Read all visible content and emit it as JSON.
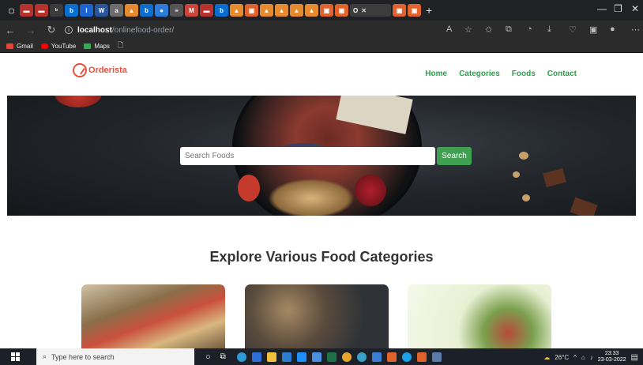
{
  "browser": {
    "active_tab_label": "O",
    "address": {
      "host": "localhost",
      "path": "/onlinefood-order/"
    },
    "bookmarks": [
      {
        "label": "Gmail",
        "color": "#e94335"
      },
      {
        "label": "YouTube",
        "color": "#ff0000"
      },
      {
        "label": "Maps",
        "color": "#34a853"
      }
    ]
  },
  "site": {
    "logo_text": "Orderista",
    "menu": [
      "Home",
      "Categories",
      "Foods",
      "Contact"
    ],
    "search_placeholder": "Search Foods",
    "search_button": "Search",
    "section_title": "Explore Various Food Categories"
  },
  "taskbar": {
    "search_placeholder": "Type here to search",
    "temperature": "26°C",
    "time": "23:33",
    "date": "23-03-2022"
  },
  "colors": {
    "accent_green": "#3fa052",
    "brand_red": "#e8513d"
  }
}
